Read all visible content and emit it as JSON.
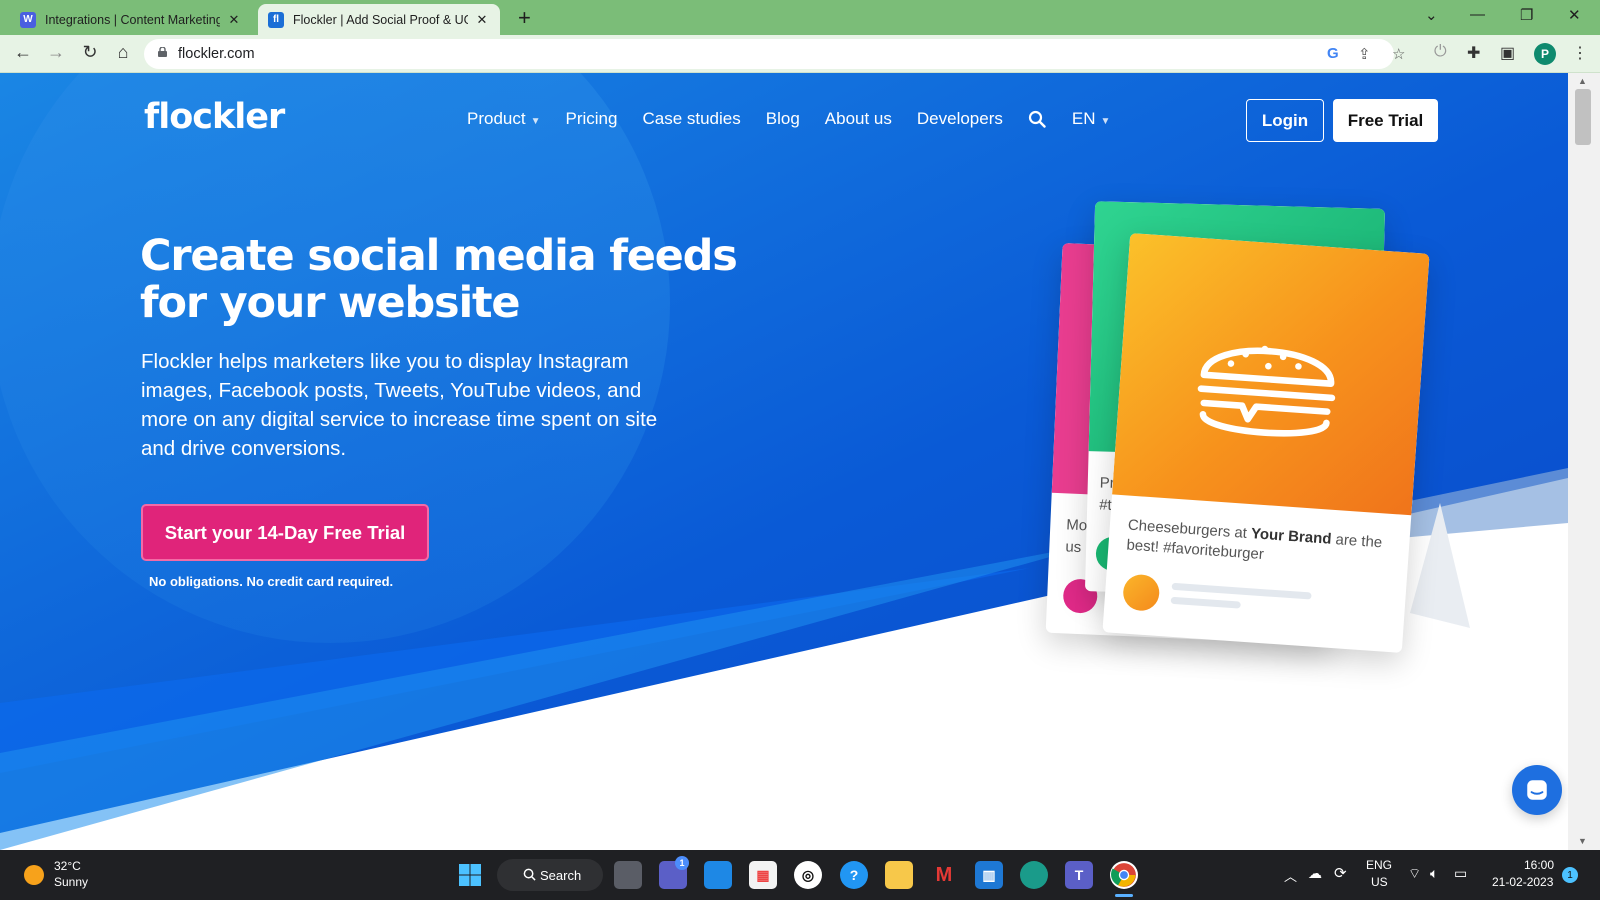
{
  "browser": {
    "tabs": [
      {
        "title": "Integrations | Content Marketing",
        "favicon": "W",
        "favicon_color": "#4a5fe0"
      },
      {
        "title": "Flockler | Add Social Proof & UGC",
        "favicon": "fl",
        "favicon_color": "#1b6fd6"
      }
    ],
    "url": "flockler.com",
    "profile_initial": "P"
  },
  "site": {
    "logo": "flockler",
    "nav": {
      "product": "Product",
      "pricing": "Pricing",
      "case_studies": "Case studies",
      "blog": "Blog",
      "about": "About us",
      "developers": "Developers",
      "language": "EN"
    },
    "login_label": "Login",
    "trial_label": "Free Trial",
    "headline": "Create social media feeds for your website",
    "subtext": "Flockler helps marketers like you to display Instagram images, Facebook posts, Tweets, YouTube videos, and more on any digital service to increase time spent on site and drive conversions.",
    "cta_label": "Start your 14-Day Free Trial",
    "cta_note": "No obligations. No credit card required.",
    "cards": {
      "front_text_pre": "Cheeseburgers at ",
      "front_text_brand": "Your Brand",
      "front_text_post": " are the best! #favoriteburger",
      "middle_text_1": "Pra",
      "middle_text_2": "#te",
      "back_text_1": "Mo",
      "back_text_2": "us"
    }
  },
  "colors": {
    "hero_blue": "#0b5fd6",
    "cta_pink": "#e0247a",
    "card_green": "#1fbf7e",
    "card_pink": "#e83d8f",
    "card_orange": "#f89b1c"
  },
  "taskbar": {
    "weather_temp": "32°C",
    "weather_cond": "Sunny",
    "search_label": "Search",
    "lang_1": "ENG",
    "lang_2": "US",
    "time": "16:00",
    "date": "21-02-2023",
    "notification_count": "1",
    "chat_badge": "1"
  }
}
